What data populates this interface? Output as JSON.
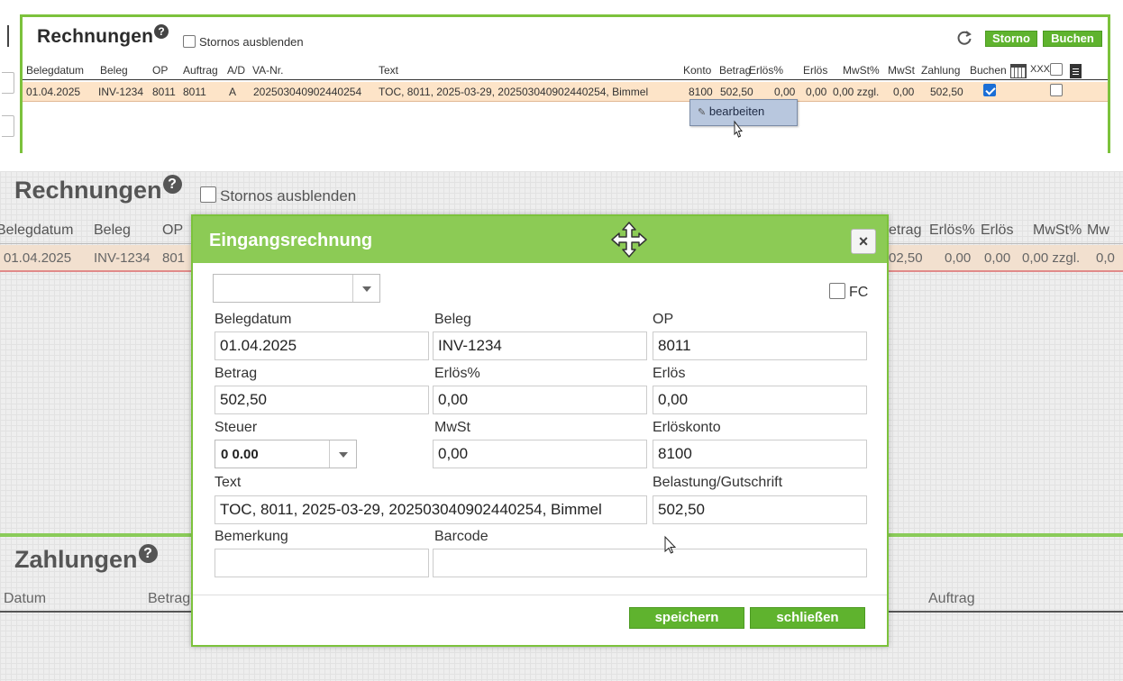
{
  "top": {
    "title": "Rechnungen",
    "help": "?",
    "hide_storno_label": "Stornos ausblenden",
    "refresh_icon": "refresh-icon",
    "storno_label": "Storno",
    "buchen_label": "Buchen",
    "columns": [
      "Belegdatum",
      "Beleg",
      "OP",
      "Auftrag",
      "A/D",
      "VA-Nr.",
      "Text",
      "Konto",
      "Betrag",
      "Erlös%",
      "Erlös",
      "MwSt%",
      "MwSt",
      "Zahlung",
      "Buchen",
      "XXX"
    ],
    "row": {
      "belegdatum": "01.04.2025",
      "beleg": "INV-1234",
      "op": "8011",
      "auftrag": "8011",
      "ad": "A",
      "va_nr": "202503040902440254",
      "text": "TOC, 8011, 2025-03-29, 202503040902440254, Bimmel",
      "konto": "8100",
      "betrag": "502,50",
      "erloes_pct": "0,00",
      "erloes": "0,00",
      "mwst_pct": "0,00 zzgl.",
      "mwst": "0,00",
      "zahlung": "502,50",
      "buchen_checked": true,
      "xxx_checked": false
    },
    "context_menu": {
      "edit_label": "bearbeiten",
      "icon": "pencil-icon"
    }
  },
  "background": {
    "title": "Rechnungen",
    "help": "?",
    "hide_storno_label": "Stornos ausblenden",
    "columns_left": [
      "Belegdatum",
      "Beleg",
      "OP"
    ],
    "columns_right": [
      "etrag",
      "Erlös%",
      "Erlös",
      "MwSt%",
      "Mw"
    ],
    "row_left": [
      "01.04.2025",
      "INV-1234",
      "801"
    ],
    "row_right": [
      "02,50",
      "0,00",
      "0,00",
      "0,00 zzgl.",
      "0,0"
    ],
    "payments_title": "Zahlungen",
    "payments_columns": [
      "Datum",
      "Betrag",
      "Auftrag"
    ]
  },
  "dialog": {
    "title": "Eingangsrechnung",
    "close": "×",
    "fc_label": "FC",
    "labels": {
      "belegdatum": "Belegdatum",
      "beleg": "Beleg",
      "op": "OP",
      "betrag": "Betrag",
      "erloes_pct": "Erlös%",
      "erloes": "Erlös",
      "steuer": "Steuer",
      "mwst": "MwSt",
      "erloeskonto": "Erlöskonto",
      "text": "Text",
      "belastung": "Belastung/Gutschrift",
      "bemerkung": "Bemerkung",
      "barcode": "Barcode"
    },
    "values": {
      "belegdatum": "01.04.2025",
      "beleg": "INV-1234",
      "op": "8011",
      "betrag": "502,50",
      "erloes_pct": "0,00",
      "erloes": "0,00",
      "steuer": "0 0.00",
      "mwst": "0,00",
      "erloeskonto": "8100",
      "text": "TOC, 8011, 2025-03-29, 202503040902440254, Bimmel",
      "belastung": "502,50",
      "bemerkung": "",
      "barcode": ""
    },
    "save_label": "speichern",
    "close_label": "schließen"
  }
}
